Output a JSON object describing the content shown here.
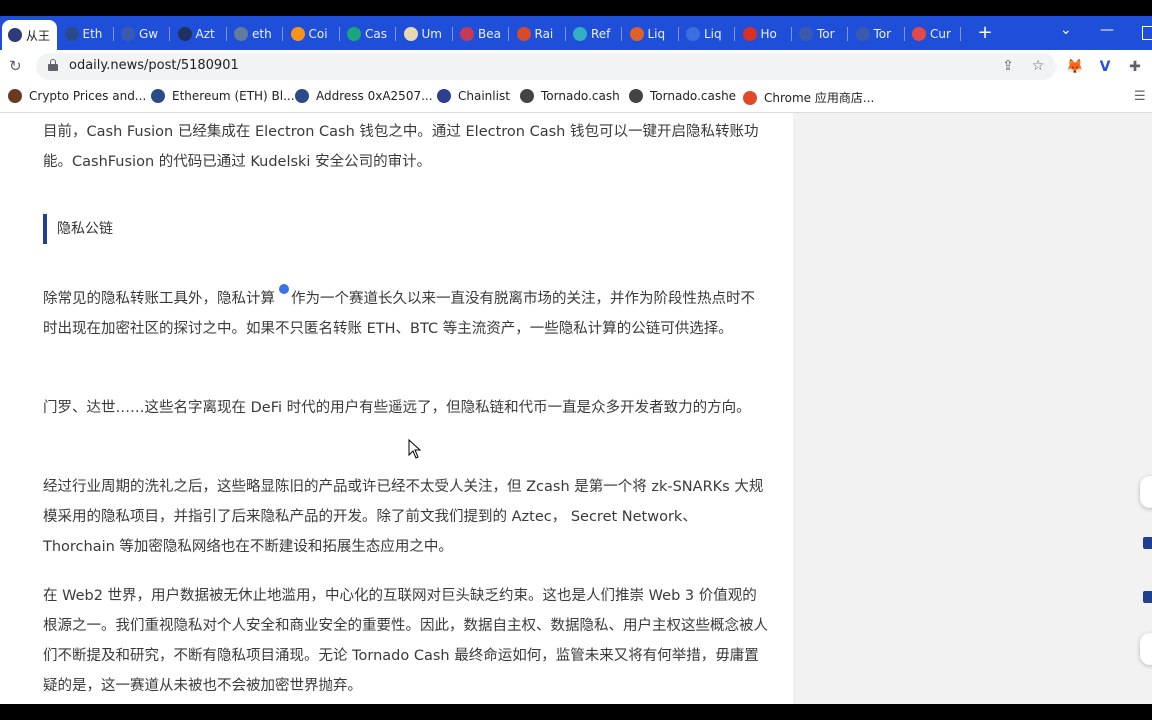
{
  "tabs": [
    {
      "label": "从王",
      "icon": "round-icon",
      "color": "#2d3b7a"
    },
    {
      "label": "Eth",
      "icon": "etherscan-icon",
      "color": "#2a4a8a"
    },
    {
      "label": "Gw",
      "icon": "gwei-icon",
      "color": "#3a5ab0"
    },
    {
      "label": "Azt",
      "icon": "aztec-icon",
      "color": "#22305e"
    },
    {
      "label": "eth",
      "icon": "globe-icon",
      "color": "#607d9c"
    },
    {
      "label": "Coi",
      "icon": "coin-icon",
      "color": "#f7931a"
    },
    {
      "label": "Cas",
      "icon": "cash-icon",
      "color": "#19a67a"
    },
    {
      "label": "Um",
      "icon": "um-icon",
      "color": "#e8d9b0"
    },
    {
      "label": "Bea",
      "icon": "bear-icon",
      "color": "#c43b5a"
    },
    {
      "label": "Rai",
      "icon": "rai-icon",
      "color": "#d84a2a"
    },
    {
      "label": "Ref",
      "icon": "ref-icon",
      "color": "#30b0c0"
    },
    {
      "label": "Liq",
      "icon": "liq-icon",
      "color": "#e0602a"
    },
    {
      "label": "Liq",
      "icon": "liq-blue-icon",
      "color": "#3b6fe0"
    },
    {
      "label": "Ho",
      "icon": "gmail-icon",
      "color": "#d93025"
    },
    {
      "label": "Tor",
      "icon": "tornado-icon",
      "color": "#3a5ab0"
    },
    {
      "label": "Tor",
      "icon": "tornado-icon",
      "color": "#3a5ab0"
    },
    {
      "label": "Cur",
      "icon": "curve-icon",
      "color": "#e04a4a"
    }
  ],
  "window": {
    "minimize": "—",
    "new_tab": "+"
  },
  "toolbar": {
    "url": "odaily.news/post/5180901",
    "icons": [
      "share-icon",
      "star-icon",
      "metamask-icon",
      "extension-v-icon",
      "puzzle-icon"
    ]
  },
  "bookmarks": [
    {
      "label": "Crypto Prices and...",
      "icon": "coinmarketcap-icon",
      "color": "#6b3a1e"
    },
    {
      "label": "Ethereum (ETH) Bl...",
      "icon": "etherscan-icon",
      "color": "#2a4a8a"
    },
    {
      "label": "Address 0xA2507...",
      "icon": "etherscan-icon",
      "color": "#2a4a8a"
    },
    {
      "label": "Chainlist",
      "icon": "chainlist-icon",
      "color": "#2d3f8e"
    },
    {
      "label": "Tornado.cash",
      "icon": "tornado-icon",
      "color": "#444444"
    },
    {
      "label": "Tornado.cashe",
      "icon": "tornado-icon",
      "color": "#444444"
    },
    {
      "label": "Chrome 应用商店...",
      "icon": "webstore-icon",
      "color": "#e04a2a"
    }
  ],
  "article": {
    "para1": "目前，Cash Fusion 已经集成在 Electron Cash 钱包之中。通过 Electron Cash 钱包可以一键开启隐私转账功能。CashFusion 的代码已通过 Kudelski 安全公司的审计。",
    "heading": "隐私公链",
    "para2_a": "除常见的隐私转账工具外，隐私计算",
    "para2_b": "作为一个赛道长久以来一直没有脱离市场的关注，并作为阶段性热点时不时出现在加密社区的探讨之中。如果不只匿名转账 ETH、BTC 等主流资产，一些隐私计算的公链可供选择。",
    "para3": "门罗、达世……这些名字离现在 DeFi 时代的用户有些遥远了，但隐私链和代币一直是众多开发者致力的方向。",
    "para4": "经过行业周期的洗礼之后，这些略显陈旧的产品或许已经不太受人关注，但 Zcash 是第一个将 zk-SNARKs 大规模采用的隐私项目，并指引了后来隐私产品的开发。除了前文我们提到的 Aztec， Secret Network、Thorchain 等加密隐私网络也在不断建设和拓展生态应用之中。",
    "para5": "在 Web2 世界，用户数据被无休止地滥用，中心化的互联网对巨头缺乏约束。这也是人们推崇 Web 3 价值观的根源之一。我们重视隐私对个人安全和商业安全的重要性。因此，数据自主权、数据隐私、用户主权这些概念被人们不断提及和研究，不断有隐私项目涌现。无论 Tornado Cash 最终命运如何，监管未来又将有何举措，毋庸置疑的是，这一赛道从未被也不会被加密世界抛弃。"
  },
  "colors": {
    "tabstrip": "#1f4fd8",
    "heading_bar": "#1f3f8f",
    "text": "#3a3a3a"
  }
}
